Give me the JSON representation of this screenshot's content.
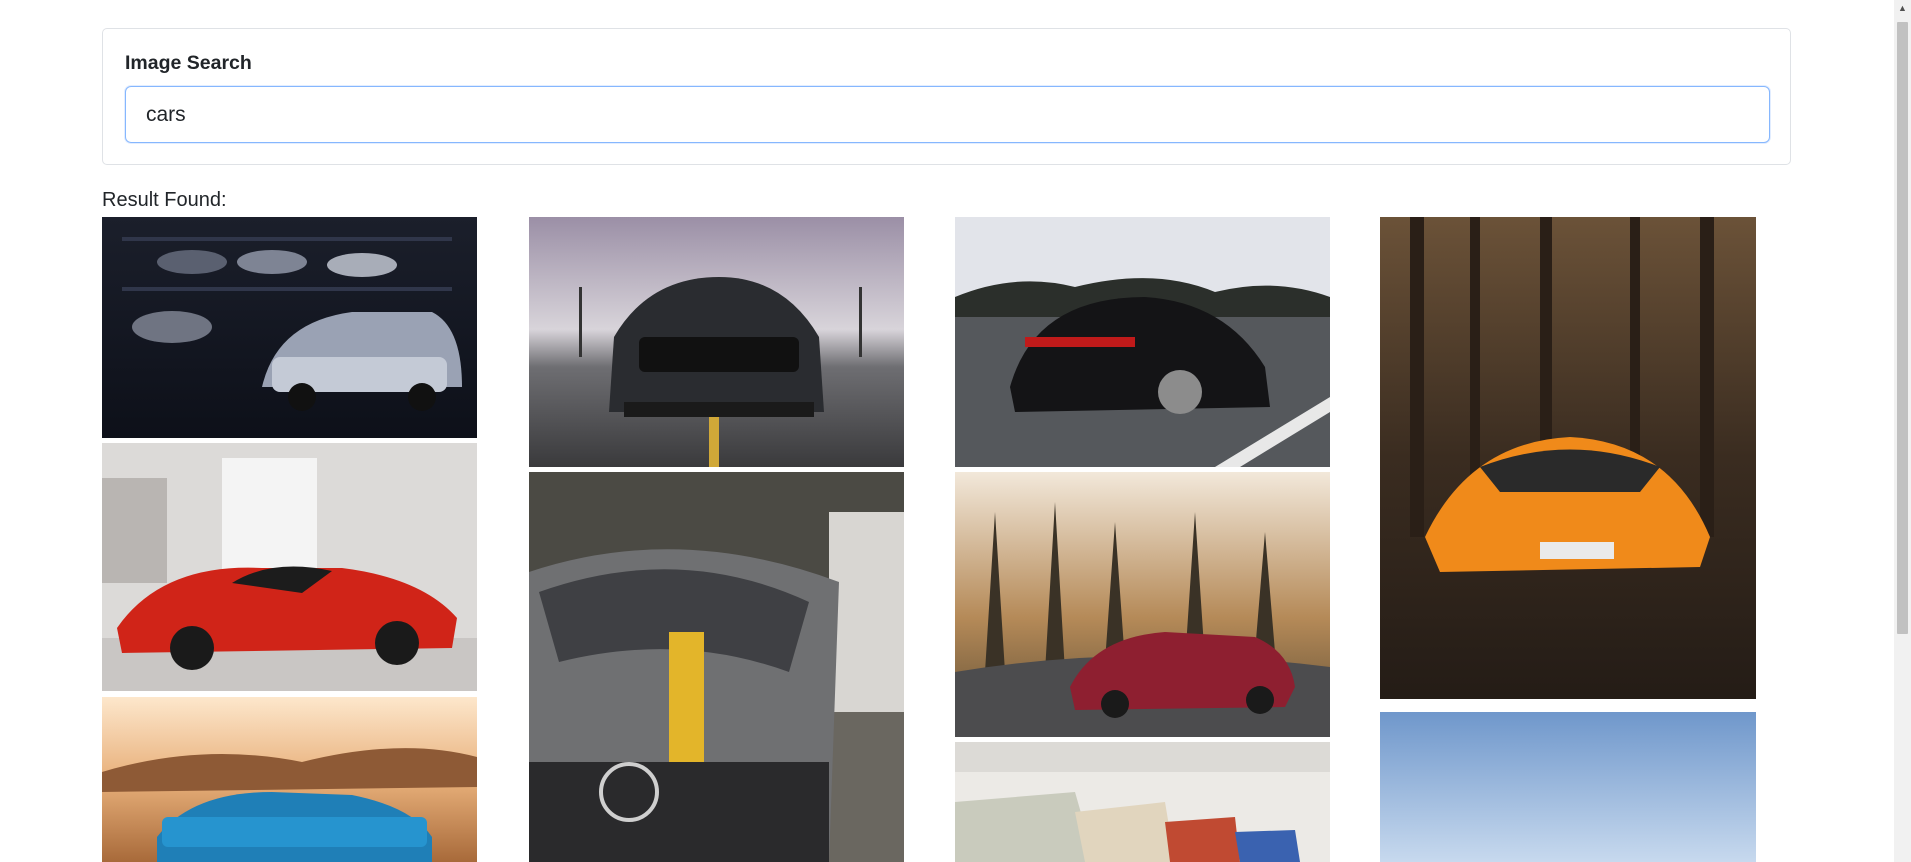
{
  "search": {
    "label": "Image Search",
    "value": "cars"
  },
  "results": {
    "label": "Result Found:",
    "images": [
      {
        "name": "car-image-camaro-garage",
        "col": 0
      },
      {
        "name": "car-image-ferrari-showroom",
        "col": 0
      },
      {
        "name": "car-image-blue-camaro-desert",
        "col": 0
      },
      {
        "name": "car-image-mustang-front",
        "col": 1
      },
      {
        "name": "car-image-mercedes-hood",
        "col": 1
      },
      {
        "name": "car-image-porsche-road",
        "col": 2
      },
      {
        "name": "car-image-amg-forest",
        "col": 2
      },
      {
        "name": "car-image-bmw-collection",
        "col": 2
      },
      {
        "name": "car-image-lamborghini-forest",
        "col": 3
      },
      {
        "name": "car-image-sky",
        "col": 3
      }
    ]
  },
  "colors": {
    "input_border": "#86b7fe",
    "card_border": "#dfe2e6",
    "text": "#212529"
  }
}
